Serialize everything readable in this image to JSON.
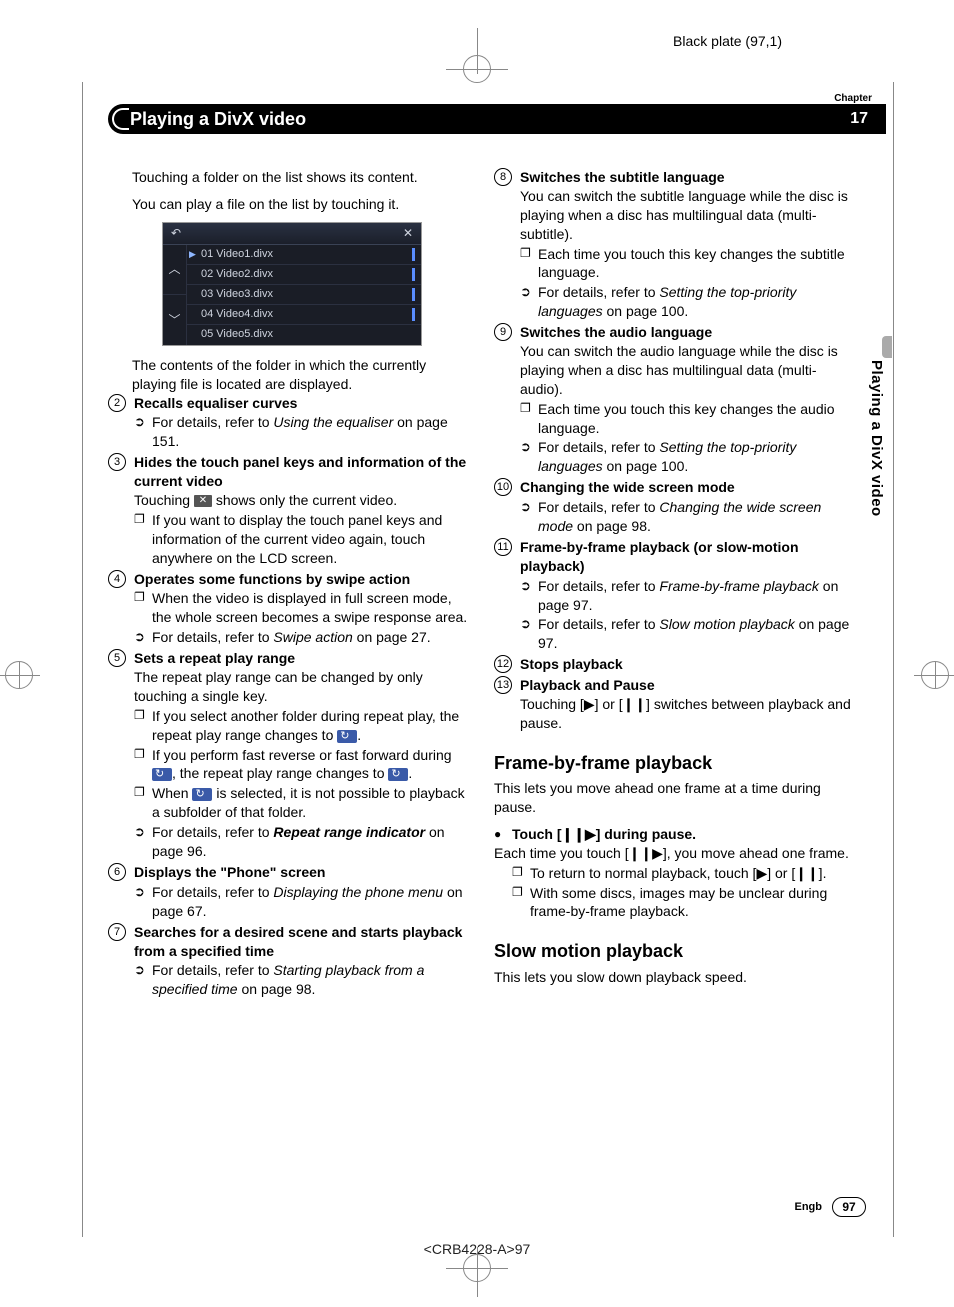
{
  "plate": "Black plate (97,1)",
  "header": {
    "chapter_label": "Chapter",
    "title": "Playing a DivX video",
    "number": "17"
  },
  "side_tab": "Playing a DivX video",
  "left": {
    "intro1": "Touching a folder on the list shows its content.",
    "intro2": "You can play a file on the list by touching it.",
    "shot_back": "↶",
    "shot_close": "✕",
    "shot_up": "︿",
    "shot_down": "﹀",
    "shot_rows": [
      "01 Video1.divx",
      "02 Video2.divx",
      "03 Video3.divx",
      "04 Video4.divx",
      "05 Video5.divx"
    ],
    "folder_note": "The contents of the folder in which the currently playing file is located are displayed.",
    "item2_h": "Recalls equaliser curves",
    "item2_ref": "For details, refer to ",
    "item2_ref_i": "Using the equaliser",
    "item2_ref_tail": " on page 151.",
    "item3_h": "Hides the touch panel keys and information of the current video",
    "item3_p": "Touching ",
    "item3_p_tail": " shows only the current video.",
    "item3_n1": "If you want to display the touch panel keys and information of the current video again, touch anywhere on the LCD screen.",
    "item4_h": "Operates some functions by swipe action",
    "item4_n1": "When the video is displayed in full screen mode, the whole screen becomes a swipe response area.",
    "item4_ref": "For details, refer to ",
    "item4_ref_i": "Swipe action",
    "item4_ref_tail": " on page 27.",
    "item5_h": "Sets a repeat play range",
    "item5_p": "The repeat play range can be changed by only touching a single key.",
    "item5_n1": "If you select another folder during repeat play, the repeat play range changes to ",
    "item5_n1_tail": ".",
    "item5_n2a": "If you perform fast reverse or fast forward during ",
    "item5_n2b": ", the repeat play range changes to ",
    "item5_n2c": ".",
    "item5_n3a": "When ",
    "item5_n3b": " is selected, it is not possible to playback a subfolder of that folder.",
    "item5_ref": "For details, refer to ",
    "item5_ref_b": "Repeat range indicator",
    "item5_ref_tail": " on page 96.",
    "item6_h": "Displays the \"Phone\" screen",
    "item6_ref": "For details, refer to ",
    "item6_ref_i": "Displaying the phone menu",
    "item6_ref_tail": " on page 67.",
    "item7_h": "Searches for a desired scene and starts playback from a specified time",
    "item7_ref": "For details, refer to ",
    "item7_ref_i": "Starting playback from a specified time",
    "item7_ref_tail": " on page 98."
  },
  "right": {
    "item8_h": "Switches the subtitle language",
    "item8_p": "You can switch the subtitle language while the disc is playing when a disc has multilingual data (multi-subtitle).",
    "item8_n1": "Each time you touch this key changes the subtitle language.",
    "item8_ref": "For details, refer to ",
    "item8_ref_i": "Setting the top-priority languages",
    "item8_ref_tail": " on page 100.",
    "item9_h": "Switches the audio language",
    "item9_p": "You can switch the audio language while the disc is playing when a disc has multilingual data (multi-audio).",
    "item9_n1": "Each time you touch this key changes the audio language.",
    "item9_ref": "For details, refer to ",
    "item9_ref_i": "Setting the top-priority languages",
    "item9_ref_tail": " on page 100.",
    "item10_h": "Changing the wide screen mode",
    "item10_ref": "For details, refer to ",
    "item10_ref_i": "Changing the wide screen mode",
    "item10_ref_tail": " on page 98.",
    "item11_h": "Frame-by-frame playback (or slow-motion playback)",
    "item11_ref1": "For details, refer to ",
    "item11_ref1_i": "Frame-by-frame playback",
    "item11_ref1_tail": " on page 97.",
    "item11_ref2": "For details, refer to ",
    "item11_ref2_i": "Slow motion playback",
    "item11_ref2_tail": " on page 97.",
    "item12_h": "Stops playback",
    "item13_h": "Playback and Pause",
    "item13_p": "Touching [▶] or [❙❙] switches between playback and pause.",
    "sec1_h": "Frame-by-frame playback",
    "sec1_p": "This lets you move ahead one frame at a time during pause.",
    "sec1_blt": "Touch [❙❙▶] during pause.",
    "sec1_p2": "Each time you touch [❙❙▶], you move ahead one frame.",
    "sec1_n1": "To return to normal playback, touch [▶] or [❙❙].",
    "sec1_n2": "With some discs, images may be unclear during frame-by-frame playback.",
    "sec2_h": "Slow motion playback",
    "sec2_p": "This lets you slow down playback speed."
  },
  "footer": {
    "lang": "Engb",
    "page": "97",
    "doc_id": "<CRB4228-A>97"
  }
}
